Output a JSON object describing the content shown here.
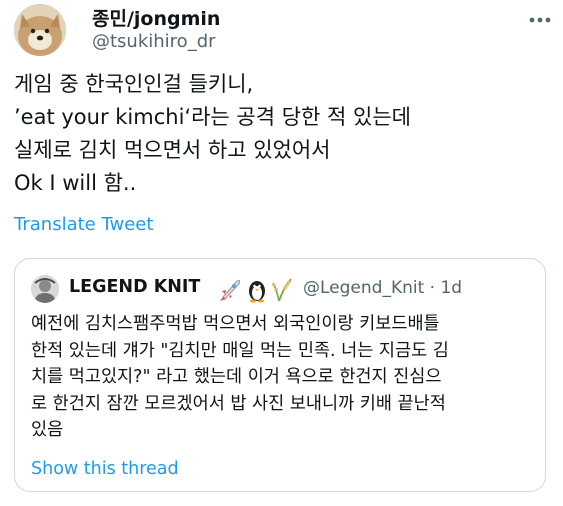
{
  "tweet": {
    "display_name": "종민/jongmin",
    "handle": "@tsukihiro_dr",
    "more_icon": "more-dots-icon",
    "text_lines": [
      "게임 중 한국인인걸 들키니,",
      "’eat your kimchi‘라는 공격 당한 적 있는데",
      "실제로 김치 먹으면서 하고 있었어서",
      "Ok I will 함.."
    ],
    "translate_label": "Translate Tweet"
  },
  "quote": {
    "display_name": "LEGEND KNIT",
    "emoji_icons": [
      "rocket-icon",
      "penguin-icon",
      "rice-plant-icon"
    ],
    "handle_time": "@Legend_Knit · 1d",
    "text_lines": [
      "예전에 김치스팸주먹밥 먹으면서 외국인이랑 키보드배틀",
      "한적 있는데 걔가 \"김치만 매일 먹는 민족. 너는 지금도 김",
      "치를 먹고있지?\" 라고 했는데 이거 욕으로 한건지 진심으",
      "로 한건지 잠깐 모르겠어서 밥 사진 보내니까 키배 끝난적",
      "있음"
    ],
    "show_thread_label": "Show this thread"
  },
  "colors": {
    "text": "#0f1419",
    "secondary": "#536471",
    "link": "#1d9bf0",
    "border": "#cfd9de"
  }
}
